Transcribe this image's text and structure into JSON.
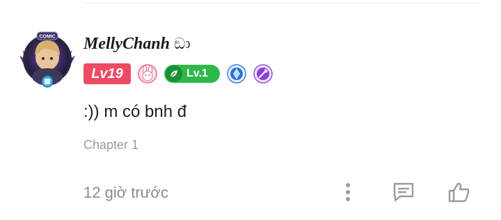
{
  "comment": {
    "username": "MellyChanh",
    "username_suffix": "ඞා",
    "level_label": "Lv19",
    "level2_label": "Lv.1",
    "text": ":)) m có bnh đ",
    "chapter": "Chapter 1",
    "time": "12 giờ trước",
    "avatar_frame_label": "COMIC"
  },
  "colors": {
    "level_badge": "#ee4a63",
    "level2_badge": "#2fb84a",
    "muted_text": "#8a8a8a"
  },
  "icons": [
    "more-vertical-icon",
    "reply-icon",
    "like-icon"
  ]
}
